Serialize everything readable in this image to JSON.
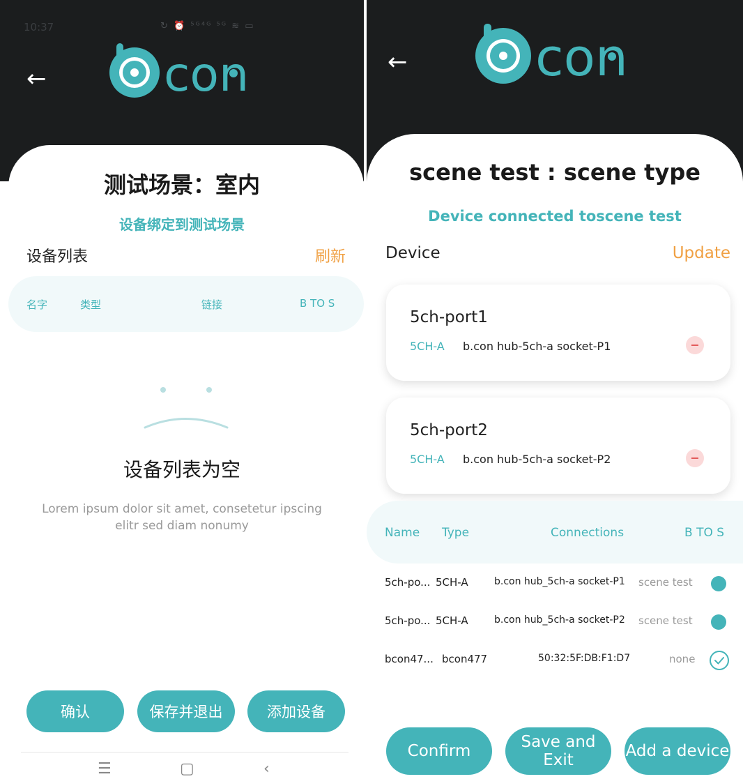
{
  "left": {
    "status": {
      "time": "10:37",
      "icons": "↻ ⏰ ⁵ᴳ⁴ᴳ ⁵ᴳ ≋ ▭"
    },
    "logo_text": "con",
    "title": "测试场景：室内",
    "subtitle": "设备绑定到测试场景",
    "section_label": "设备列表",
    "refresh_label": "刷新",
    "table_headers": [
      "名字",
      "类型",
      "链接",
      "B TO S"
    ],
    "empty_title": "设备列表为空",
    "empty_desc_line1": "Lorem ipsum dolor sit amet, consetetur ipscing",
    "empty_desc_line2": "elitr sed diam nonumy",
    "buttons": [
      "确认",
      "保存并退出",
      "添加设备"
    ],
    "navbar": [
      "☰",
      "▢",
      "‹"
    ]
  },
  "right": {
    "logo_text": "con",
    "title": "scene test : scene type",
    "subtitle": "Device connected toscene test",
    "section_label": "Device",
    "refresh_label": "Update",
    "cards": [
      {
        "name": "5ch-port1",
        "type": "5CH-A",
        "desc": "b.con hub-5ch-a socket-P1"
      },
      {
        "name": "5ch-port2",
        "type": "5CH-A",
        "desc": "b.con hub-5ch-a socket-P2"
      }
    ],
    "table_headers": [
      "Name",
      "Type",
      "Connections",
      "B TO S"
    ],
    "rows": [
      {
        "name": "5ch-po...",
        "type": "5CH-A",
        "conn": "b.con hub_5ch-a socket-P1",
        "scene": "scene test",
        "status": "bound"
      },
      {
        "name": "5ch-po...",
        "type": "5CH-A",
        "conn": "b.con hub_5ch-a socket-P2",
        "scene": "scene test",
        "status": "bound"
      },
      {
        "name": "bcon47...",
        "type": "bcon477",
        "conn": "50:32:5F:DB:F1:D7",
        "scene": "none",
        "status": "available"
      }
    ],
    "buttons": [
      "Confirm",
      "Save and Exit",
      "Add a device"
    ]
  },
  "colors": {
    "accent": "#44b4b9",
    "orange": "#f0a043",
    "header": "#1b1d1e",
    "remove": "#e35b5b"
  },
  "icons": {
    "back": "back-arrow-icon",
    "remove": "minus-circle-icon",
    "bound": "filled-circle-icon",
    "available": "check-circle-icon"
  }
}
